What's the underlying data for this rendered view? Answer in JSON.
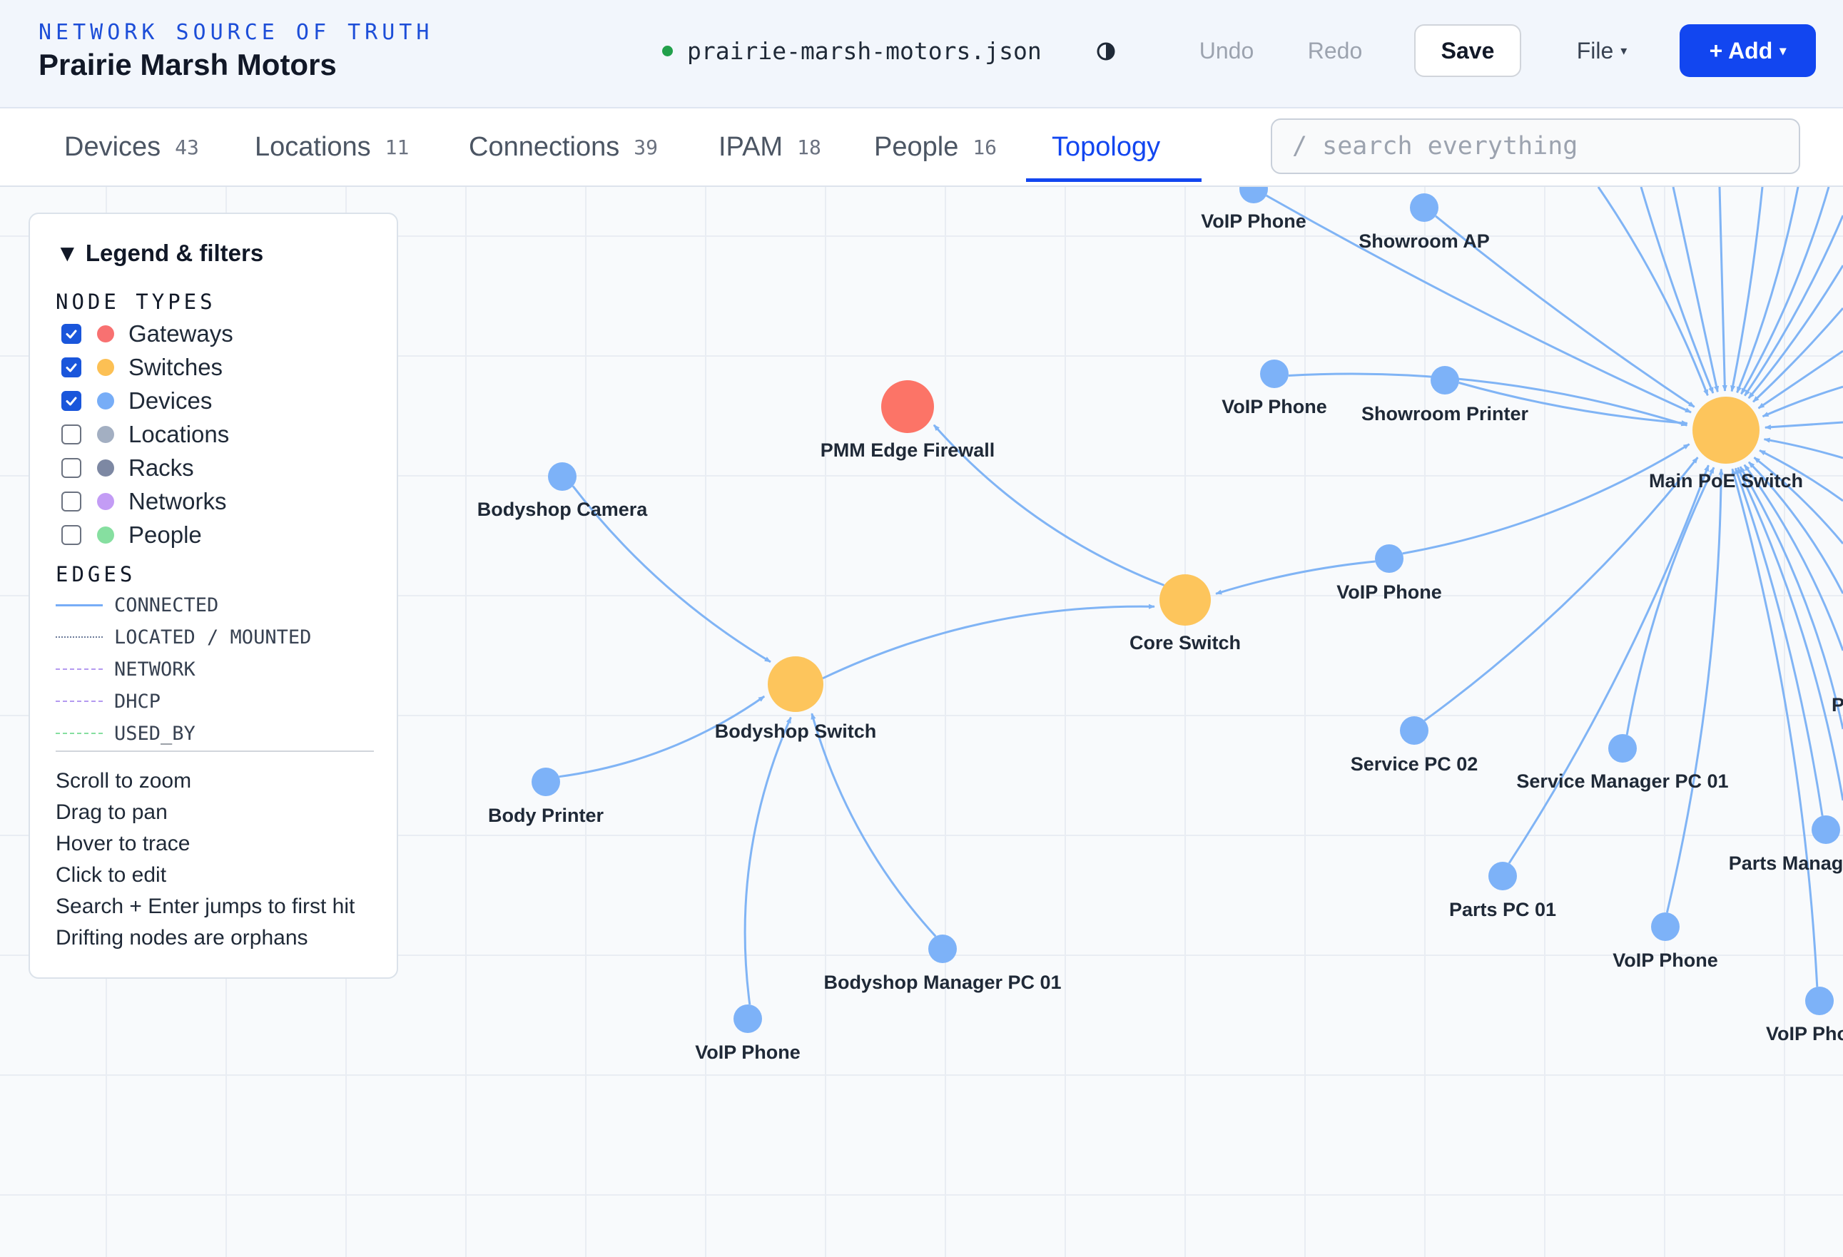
{
  "header": {
    "eyebrow": "NETWORK SOURCE OF TRUTH",
    "title": "Prairie Marsh Motors",
    "file_name": "prairie-marsh-motors.json",
    "file_status_color": "#22a04b",
    "theme_icon": "contrast-icon",
    "undo_label": "Undo",
    "redo_label": "Redo",
    "save_label": "Save",
    "file_menu_label": "File",
    "add_label": "+ Add",
    "caret": "▾"
  },
  "tabs": [
    {
      "label": "Devices",
      "count": "43"
    },
    {
      "label": "Locations",
      "count": "11"
    },
    {
      "label": "Connections",
      "count": "39"
    },
    {
      "label": "IPAM",
      "count": "18"
    },
    {
      "label": "People",
      "count": "16"
    },
    {
      "label": "Topology",
      "active": true
    }
  ],
  "search": {
    "placeholder": "/ search everything"
  },
  "legend": {
    "title": "▼ Legend & filters",
    "node_types_heading": "NODE TYPES",
    "node_types": [
      {
        "label": "Gateways",
        "checked": true,
        "color": "#f87171"
      },
      {
        "label": "Switches",
        "checked": true,
        "color": "#fcc054"
      },
      {
        "label": "Devices",
        "checked": true,
        "color": "#77adf7"
      },
      {
        "label": "Locations",
        "checked": false,
        "color": "#a3afc2"
      },
      {
        "label": "Racks",
        "checked": false,
        "color": "#7d88a3"
      },
      {
        "label": "Networks",
        "checked": false,
        "color": "#c39cf5"
      },
      {
        "label": "People",
        "checked": false,
        "color": "#86dfa0"
      }
    ],
    "edges_heading": "EDGES",
    "edge_types": [
      {
        "label": "CONNECTED",
        "style": "solid",
        "color": "#77adf7"
      },
      {
        "label": "LOCATED / MOUNTED",
        "style": "dotted",
        "color": "#6b7a99"
      },
      {
        "label": "NETWORK",
        "style": "dashed",
        "color": "#b49af0"
      },
      {
        "label": "DHCP",
        "style": "dashed-fine",
        "color": "#b49af0"
      },
      {
        "label": "USED_BY",
        "style": "dash-dot",
        "color": "#86dfa0"
      }
    ],
    "help": [
      "Scroll to zoom",
      "Drag to pan",
      "Hover to trace",
      "Click to edit",
      "Search + Enter jumps to first hit",
      "Drifting nodes are orphans"
    ]
  },
  "topology": {
    "colors": {
      "gateway": "#fc7467",
      "switch": "#fdc55c",
      "device": "#7db2f8",
      "edge": "#80b4f5"
    },
    "nodes": [
      {
        "id": "fw",
        "label": "PMM Edge Firewall",
        "type": "gateway"
      },
      {
        "id": "core",
        "label": "Core Switch",
        "type": "switch"
      },
      {
        "id": "body_sw",
        "label": "Bodyshop Switch",
        "type": "switch"
      },
      {
        "id": "main_poe",
        "label": "Main PoE Switch",
        "type": "switch"
      },
      {
        "id": "body_cam",
        "label": "Bodyshop Camera",
        "type": "device"
      },
      {
        "id": "body_printer",
        "label": "Body Printer",
        "type": "device"
      },
      {
        "id": "voip_body",
        "label": "VoIP Phone",
        "type": "device"
      },
      {
        "id": "body_mgr_pc",
        "label": "Bodyshop Manager PC 01",
        "type": "device"
      },
      {
        "id": "voip_top",
        "label": "VoIP Phone",
        "type": "device"
      },
      {
        "id": "showroom_ap",
        "label": "Showroom AP",
        "type": "device"
      },
      {
        "id": "voip_mid",
        "label": "VoIP Phone",
        "type": "device"
      },
      {
        "id": "showroom_printer",
        "label": "Showroom Printer",
        "type": "device"
      },
      {
        "id": "voip_core",
        "label": "VoIP Phone",
        "type": "device"
      },
      {
        "id": "service_pc02",
        "label": "Service PC 02",
        "type": "device"
      },
      {
        "id": "svc_mgr_pc",
        "label": "Service Manager PC 01",
        "type": "device"
      },
      {
        "id": "parts_pc01",
        "label": "Parts PC 01",
        "type": "device"
      },
      {
        "id": "voip_bottom",
        "label": "VoIP Phone",
        "type": "device"
      },
      {
        "id": "parts_mgr",
        "label": "Parts Manag",
        "type": "device"
      },
      {
        "id": "voip_corner",
        "label": "VoIP Pho",
        "type": "device"
      },
      {
        "id": "offscreen_p",
        "label": "P",
        "type": "device"
      }
    ],
    "edges": [
      {
        "from": "body_cam",
        "to": "body_sw"
      },
      {
        "from": "body_printer",
        "to": "body_sw"
      },
      {
        "from": "voip_body",
        "to": "body_sw"
      },
      {
        "from": "body_mgr_pc",
        "to": "body_sw"
      },
      {
        "from": "body_sw",
        "to": "core"
      },
      {
        "from": "core",
        "to": "fw"
      },
      {
        "from": "voip_core",
        "to": "core"
      },
      {
        "from": "voip_core",
        "to": "main_poe"
      },
      {
        "from": "voip_top",
        "to": "main_poe"
      },
      {
        "from": "showroom_ap",
        "to": "main_poe"
      },
      {
        "from": "voip_mid",
        "to": "main_poe"
      },
      {
        "from": "showroom_printer",
        "to": "main_poe"
      },
      {
        "from": "service_pc02",
        "to": "main_poe"
      },
      {
        "from": "svc_mgr_pc",
        "to": "main_poe"
      },
      {
        "from": "parts_pc01",
        "to": "main_poe"
      },
      {
        "from": "voip_bottom",
        "to": "main_poe"
      },
      {
        "from": "parts_mgr",
        "to": "main_poe"
      },
      {
        "from": "voip_corner",
        "to": "main_poe"
      }
    ]
  }
}
